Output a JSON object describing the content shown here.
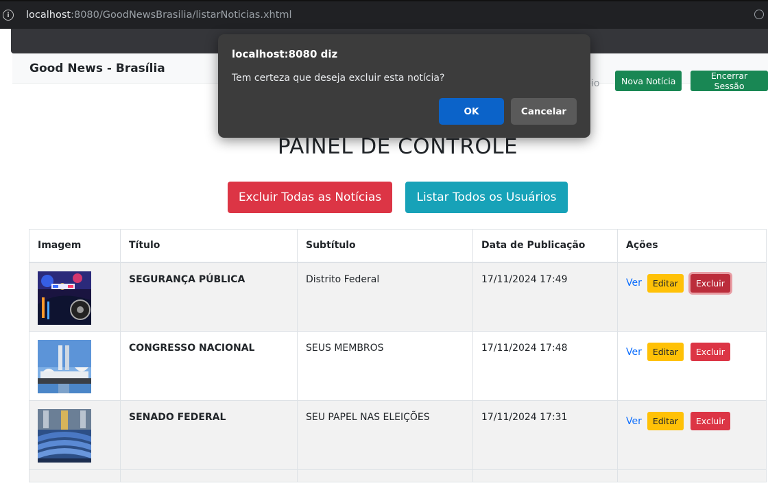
{
  "browser": {
    "url_host": "localhost",
    "url_path": ":8080/GoodNewsBrasilia/listarNoticias.xhtml"
  },
  "navbar": {
    "brand": "Good News - Brasília",
    "faded_text": "io",
    "new_news_label": "Nova Notícia",
    "logout_label": "Encerrar Sessão"
  },
  "main": {
    "heading": "PAINEL DE CONTROLE",
    "delete_all_label": "Excluir Todas as Notícias",
    "list_users_label": "Listar Todos os Usuários"
  },
  "table": {
    "headers": [
      "Imagem",
      "Título",
      "Subtítulo",
      "Data de Publicação",
      "Ações"
    ],
    "rows": [
      {
        "title": "SEGURANÇA PÚBLICA",
        "subtitle": "Distrito Federal",
        "date": "17/11/2024 17:49",
        "image": "police-car-image"
      },
      {
        "title": "CONGRESSO NACIONAL",
        "subtitle": "SEUS MEMBROS",
        "date": "17/11/2024 17:48",
        "image": "congress-building-image"
      },
      {
        "title": "SENADO FEDERAL",
        "subtitle": "SEU PAPEL NAS ELEIÇÕES",
        "date": "17/11/2024 17:31",
        "image": "senate-chamber-image"
      }
    ],
    "action_view": "Ver",
    "action_edit": "Editar",
    "action_delete": "Excluir"
  },
  "dialog": {
    "title": "localhost:8080 diz",
    "message": "Tem certeza que deseja excluir esta notícia?",
    "ok_label": "OK",
    "cancel_label": "Cancelar"
  },
  "colors": {
    "success": "#198754",
    "danger": "#dc3545",
    "info": "#17a2b8",
    "warning": "#ffc107",
    "primary": "#0b63c9"
  }
}
